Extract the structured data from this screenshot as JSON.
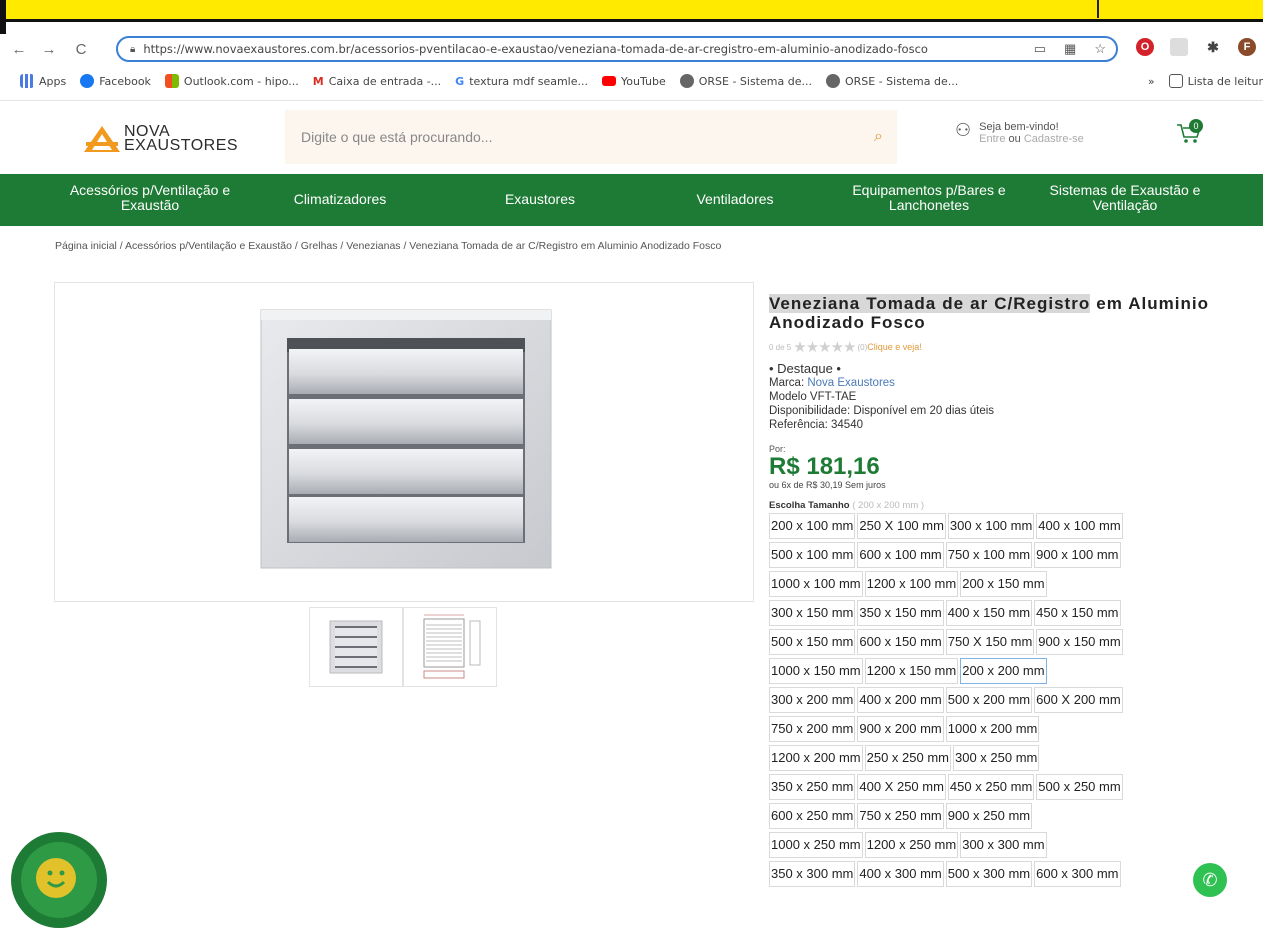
{
  "browser": {
    "url": "https://www.novaexaustores.com.br/acessorios-pventilacao-e-exaustao/veneziana-tomada-de-ar-cregistro-em-aluminio-anodizado-fosco",
    "profile_initial": "F",
    "bookmarks": [
      {
        "label": "Apps",
        "color": "#4a7be0"
      },
      {
        "label": "Facebook",
        "color": "#1877f2"
      },
      {
        "label": "Outlook.com - hipo...",
        "color": "#f25022"
      },
      {
        "label": "Caixa de entrada -...",
        "color": "#d93025"
      },
      {
        "label": "textura mdf seamle...",
        "color": "#4285f4"
      },
      {
        "label": "YouTube",
        "color": "#ff0000"
      },
      {
        "label": "ORSE - Sistema de...",
        "color": "#555555"
      },
      {
        "label": "ORSE - Sistema de...",
        "color": "#555555"
      }
    ],
    "bookmarks_more": "»",
    "reading_list": "Lista de leitur"
  },
  "header": {
    "logo_line1": "NOVA",
    "logo_line2": "EXAUSTORES",
    "search_placeholder": "Digite o que está procurando...",
    "welcome": "Seja bem-vindo!",
    "login": "Entre",
    "or": "ou",
    "register": "Cadastre-se",
    "cart_count": "0"
  },
  "nav": [
    {
      "label": "Acessórios p/Ventilação e Exaustão"
    },
    {
      "label": "Climatizadores"
    },
    {
      "label": "Exaustores"
    },
    {
      "label": "Ventiladores"
    },
    {
      "label": "Equipamentos p/Bares e Lanchonetes"
    },
    {
      "label": "Sistemas de Exaustão e Ventilação"
    }
  ],
  "breadcrumb": "Página inicial / Acessórios p/Ventilação e Exaustão / Grelhas / Venezianas /  Veneziana Tomada de ar C/Registro em Aluminio Anodizado Fosco",
  "product": {
    "title_highlight": "Veneziana Tomada de ar C/Registro",
    "title_rest": " em Aluminio Anodizado Fosco",
    "rating_prefix": "0 de 5",
    "rating_count": "(0)",
    "rating_cta": "Clique e veja!",
    "tag": "• Destaque •",
    "brand_label": "Marca: ",
    "brand": "Nova Exaustores",
    "model": "Modelo VFT-TAE",
    "availability": "Disponibilidade: Disponível em 20 dias úteis",
    "reference": "Referência: 34540",
    "price_label": "Por:",
    "price": "R$ 181,16",
    "installments": "ou 6x de R$ 30,19 Sem juros",
    "size_label": "Escolha Tamanho",
    "size_selected": "( 200 x 200 mm )",
    "sizes": [
      "200 x 100 mm",
      "250 X 100 mm",
      "300 x 100 mm",
      "400 x 100 mm",
      "500 x 100 mm",
      "600 x 100 mm",
      "750 x 100 mm",
      "900 x 100 mm",
      "1000 x 100 mm",
      "1200 x 100 mm",
      "200 x 150 mm",
      "300 x 150 mm",
      "350 x 150 mm",
      "400 x 150 mm",
      "450 x 150 mm",
      "500 x 150 mm",
      "600 x 150 mm",
      "750 X 150 mm",
      "900 x 150 mm",
      "1000 x 150 mm",
      "1200 x 150 mm",
      "200 x 200 mm",
      "300 x 200 mm",
      "400 x 200 mm",
      "500 x 200 mm",
      "600 X 200 mm",
      "750 x 200 mm",
      "900 x 200 mm",
      "1000 x 200 mm",
      "1200 x 200 mm",
      "250 x 250 mm",
      "300 x 250 mm",
      "350 x 250 mm",
      "400 X 250 mm",
      "450 x 250 mm",
      "500 x 250 mm",
      "600 x 250 mm",
      "750 x 250 mm",
      "900 x 250 mm",
      "1000 x 250 mm",
      "1200 x 250 mm",
      "300 x 300 mm",
      "350 x 300 mm",
      "400 x 300 mm",
      "500 x 300 mm",
      "600 x 300 mm"
    ],
    "selected_size_index": 21
  },
  "colors": {
    "brand_green": "#1e7b35",
    "accent_orange": "#e09a3c",
    "whatsapp": "#2fc152"
  }
}
